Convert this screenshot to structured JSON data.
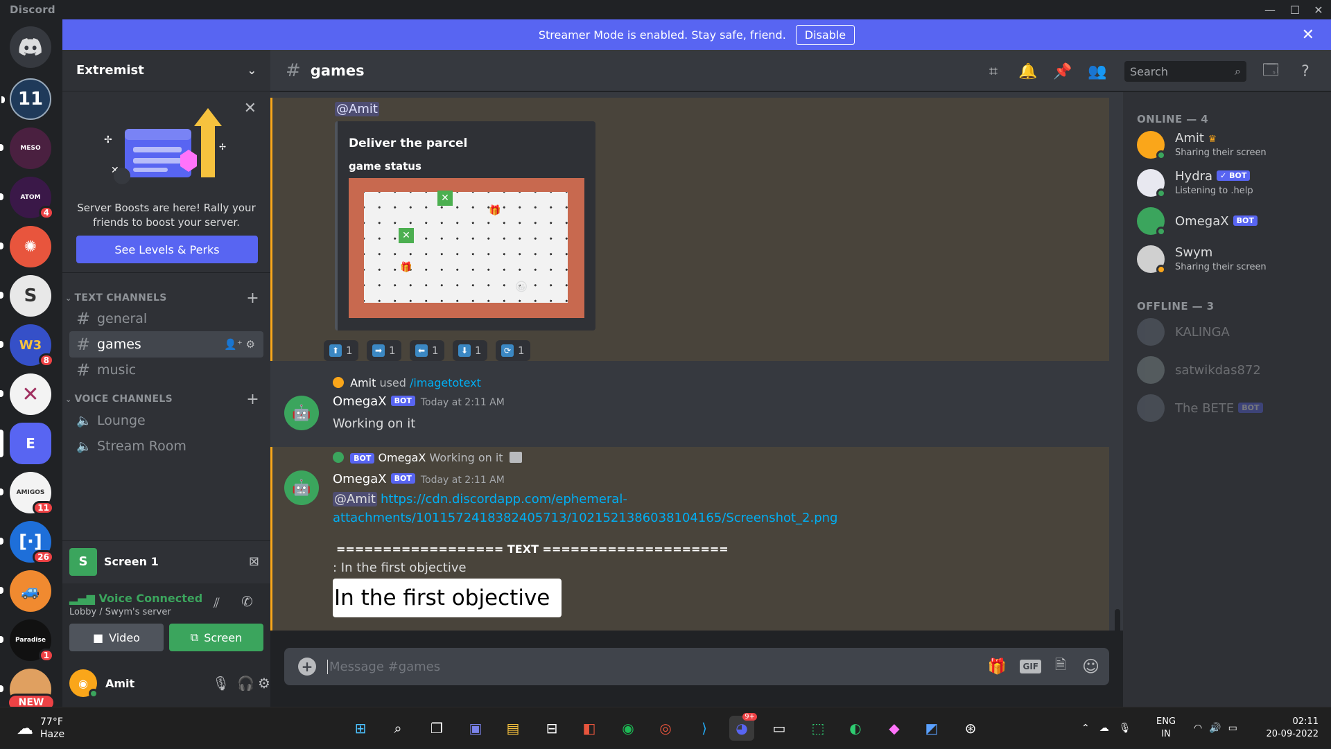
{
  "window": {
    "app_name": "Discord"
  },
  "banner": {
    "text": "Streamer Mode is enabled. Stay safe, friend.",
    "button": "Disable"
  },
  "servers": [
    {
      "label": "",
      "badge": ""
    },
    {
      "label": "",
      "badge": ""
    },
    {
      "label": "",
      "badge": "4"
    },
    {
      "label": "",
      "badge": ""
    },
    {
      "label": "",
      "badge": ""
    },
    {
      "label": "W3",
      "badge": "8"
    },
    {
      "label": "",
      "badge": ""
    },
    {
      "label": "E",
      "badge": ""
    },
    {
      "label": "",
      "badge": "11"
    },
    {
      "label": "",
      "badge": "26"
    },
    {
      "label": "",
      "badge": ""
    },
    {
      "label": "",
      "badge": "1"
    },
    {
      "label": "",
      "badge": "NEW"
    }
  ],
  "guild": {
    "name": "Extremist"
  },
  "boost": {
    "text": "Server Boosts are here! Rally your friends to boost your server.",
    "button": "See Levels & Perks"
  },
  "text_channels": {
    "label": "TEXT CHANNELS",
    "items": [
      "general",
      "games",
      "music"
    ]
  },
  "voice_channels": {
    "label": "VOICE CHANNELS",
    "items": [
      "Lounge",
      "Stream Room"
    ]
  },
  "stream_panel": {
    "title": "Screen 1",
    "icon_letter": "S"
  },
  "voice_panel": {
    "status": "Voice Connected",
    "location": "Lobby / Swym's server",
    "video_label": "Video",
    "screen_label": "Screen"
  },
  "user_panel": {
    "name": "Amit"
  },
  "channel_header": {
    "name": "games",
    "search_placeholder": "Search"
  },
  "messages": {
    "embed_mention": "@Amit",
    "embed_title": "Deliver the parcel",
    "embed_subtitle": "game status",
    "reactions": [
      {
        "icon": "up-arrow",
        "count": "1"
      },
      {
        "icon": "right-arrow",
        "count": "1"
      },
      {
        "icon": "left-arrow",
        "count": "1"
      },
      {
        "icon": "down-arrow",
        "count": "1"
      },
      {
        "icon": "refresh",
        "count": "1"
      }
    ],
    "reply1": {
      "user": "Amit",
      "used": "used",
      "command": "/imagetotext"
    },
    "msg1": {
      "author": "OmegaX",
      "bot": "BOT",
      "time": "Today at 2:11 AM",
      "text": "Working on it"
    },
    "reply2": {
      "bot": "BOT",
      "author": "OmegaX",
      "text": "Working on it"
    },
    "msg2": {
      "author": "OmegaX",
      "bot": "BOT",
      "time": "Today at 2:11 AM",
      "mention": "@Amit",
      "link1": "https://cdn.discordapp.com/ephemeral-",
      "link2": "attachments/1011572418382405713/1021521386038104165/Screenshot_2.png",
      "divider": "================== TEXT ====================",
      "line": ": In the first objective",
      "image_text": "In the first objective"
    }
  },
  "composer": {
    "placeholder": "Message #games"
  },
  "members": {
    "online_header": "ONLINE — 4",
    "offline_header": "OFFLINE — 3",
    "online": [
      {
        "name": "Amit",
        "status": "Sharing their screen",
        "bot": ""
      },
      {
        "name": "Hydra",
        "status": "Listening to .help",
        "bot": "✓ BOT"
      },
      {
        "name": "OmegaX",
        "status": "",
        "bot": "BOT"
      },
      {
        "name": "Swym",
        "status": "Sharing their screen",
        "bot": ""
      }
    ],
    "offline": [
      {
        "name": "KALINGA",
        "bot": ""
      },
      {
        "name": "satwikdas872",
        "bot": ""
      },
      {
        "name": "The BETE",
        "bot": "BOT"
      }
    ]
  },
  "taskbar": {
    "weather_temp": "77°F",
    "weather_desc": "Haze",
    "lang1": "ENG",
    "lang2": "IN",
    "time": "02:11",
    "date": "20-09-2022",
    "discord_badge": "9+"
  },
  "colors": {
    "blurple": "#5865f2",
    "green": "#3ba55d",
    "red": "#ed4245",
    "mention_highlight": "#faa81a"
  }
}
